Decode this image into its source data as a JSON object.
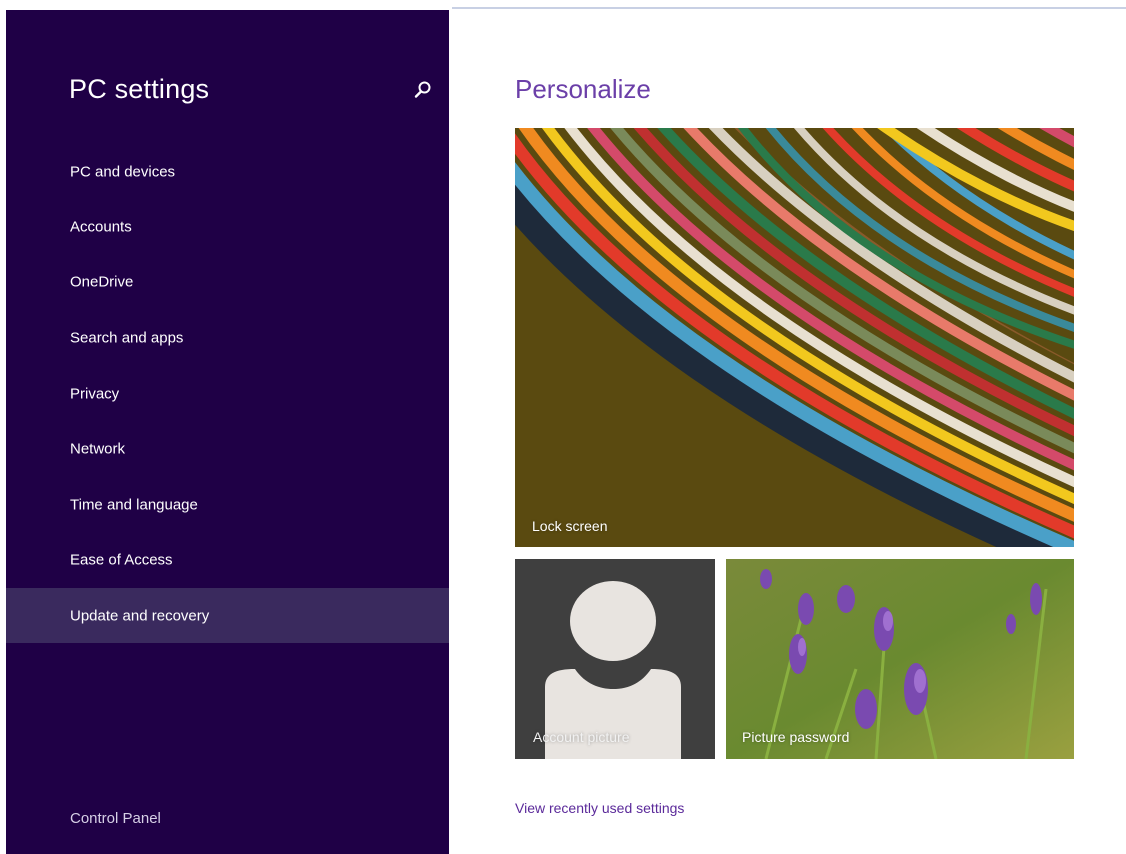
{
  "sidebar": {
    "title": "PC settings",
    "search_icon": "search-icon",
    "items": [
      {
        "label": "PC and devices",
        "selected": false
      },
      {
        "label": "Accounts",
        "selected": false
      },
      {
        "label": "OneDrive",
        "selected": false
      },
      {
        "label": "Search and apps",
        "selected": false
      },
      {
        "label": "Privacy",
        "selected": false
      },
      {
        "label": "Network",
        "selected": false
      },
      {
        "label": "Time and language",
        "selected": false
      },
      {
        "label": "Ease of Access",
        "selected": false
      },
      {
        "label": "Update and recovery",
        "selected": true
      }
    ],
    "footer_link": "Control Panel"
  },
  "main": {
    "title": "Personalize",
    "tiles": {
      "lock_screen": "Lock screen",
      "account_picture": "Account picture",
      "picture_password": "Picture password"
    },
    "recent_link": "View recently used settings"
  },
  "colors": {
    "sidebar_bg": "#1f0046",
    "selected_bg": "#3a2a5e",
    "accent": "#6b3fa8",
    "link": "#5b2a9a"
  }
}
